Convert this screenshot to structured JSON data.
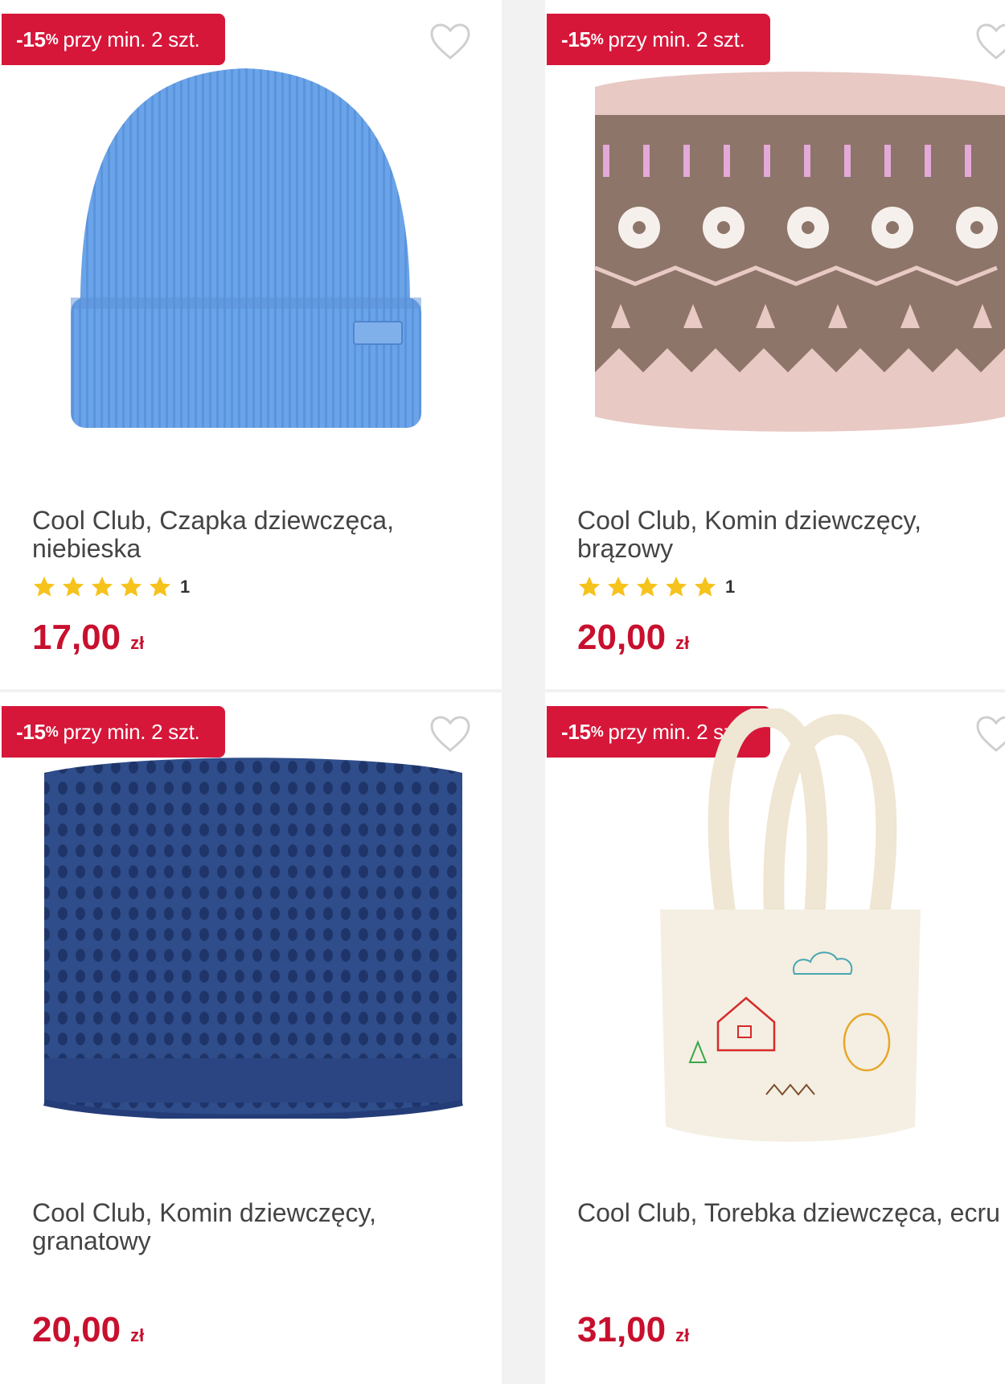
{
  "products": [
    {
      "badge": {
        "discount": "-15",
        "percent": "%",
        "text": "przy min. 2 szt."
      },
      "title": "Cool Club, Czapka dziewczęca, niebieska",
      "rating": {
        "stars": 5,
        "count": "1"
      },
      "price": "17,00",
      "currency": "zł",
      "image_icon": "blue-beanie-image"
    },
    {
      "badge": {
        "discount": "-15",
        "percent": "%",
        "text": "przy min. 2 szt."
      },
      "title": "Cool Club, Komin dziewczęcy, brązowy",
      "rating": {
        "stars": 5,
        "count": "1"
      },
      "price": "20,00",
      "currency": "zł",
      "image_icon": "pink-snowflake-snood-image"
    },
    {
      "badge": {
        "discount": "-15",
        "percent": "%",
        "text": "przy min. 2 szt."
      },
      "title": "Cool Club, Komin dziewczęcy, granatowy",
      "price": "20,00",
      "currency": "zł",
      "image_icon": "navy-knit-snood-image"
    },
    {
      "badge": {
        "discount": "-15",
        "percent": "%",
        "text": "przy min. 2 szt."
      },
      "title": "Cool Club, Torebka dziewczęca, ecru",
      "price": "31,00",
      "currency": "zł",
      "image_icon": "ecru-tote-bag-image"
    }
  ],
  "colors": {
    "accent": "#d6173a",
    "price": "#c8102e",
    "star": "#f6c21c",
    "heart": "#cfcfcf"
  }
}
